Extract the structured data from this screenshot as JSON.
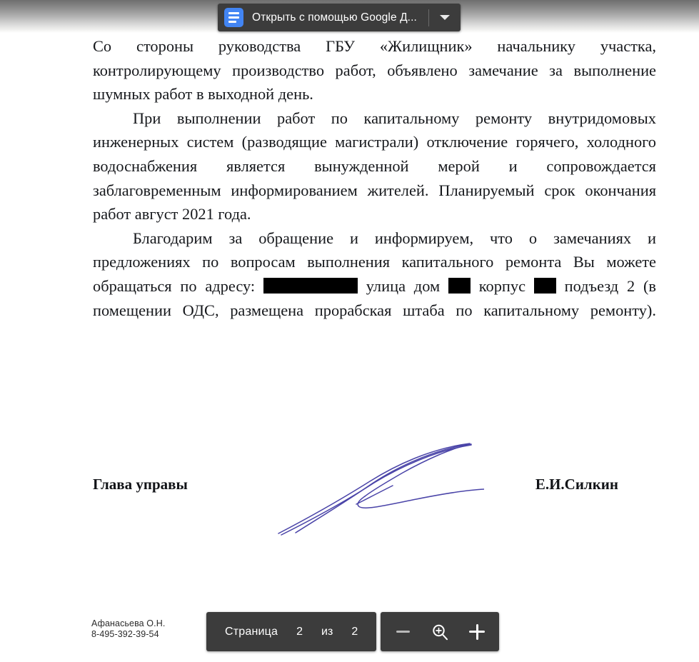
{
  "viewer": {
    "background_color": "#ffffff",
    "toolbar_color": "#3c3c3c"
  },
  "open_with_bar": {
    "icon": "google-docs-icon",
    "icon_color": "#4285f4",
    "label": "Открыть с помощью Google Д...",
    "caret_icon": "chevron-down-icon"
  },
  "document": {
    "paragraphs": [
      {
        "id": "p1",
        "indent": false,
        "segments": [
          {
            "text": "Со стороны руководства "
          },
          {
            "text": "ГБУ «Жилищник»",
            "underline_color": "#e02020"
          },
          {
            "text": " начальнику участка, контролирующему производство работ, объявлено замечание за выполнение шумных работ в выходной день."
          }
        ]
      },
      {
        "id": "p2",
        "indent": true,
        "segments": [
          {
            "text": "При выполнении работ по капитальному ремонту внутридомовых инженерных систем (разводящие магистрали) отключение горячего, холодного водоснабжения является вынужденной мерой и сопровождается заблаговременным информированием жителей. Планируемый срок окончания работ август 2021 года."
          }
        ]
      },
      {
        "id": "p3",
        "indent": true,
        "segments": [
          {
            "text": "Благодарим за обращение и информируем, что о замечаниях и предложениях по вопросам выполнения капитального ремонта Вы можете обращаться по адресу: "
          },
          {
            "redacted": true,
            "size": "wide"
          },
          {
            "text": " улица дом "
          },
          {
            "redacted": true,
            "size": "narrow"
          },
          {
            "text": " корпус "
          },
          {
            "redacted": true,
            "size": "narrow"
          },
          {
            "text": " подъезд 2 (в помещении ОДС, "
          },
          {
            "text": "размещена прорабская штаба",
            "underline_color": "#e02020"
          },
          {
            "text": " по капитальному ремонту)."
          }
        ]
      }
    ],
    "signature": {
      "title": "Глава управы",
      "name": "Е.И.Силкин",
      "ink_color": "#4a44a8"
    },
    "contact": {
      "person": "Афанасьева О.Н.",
      "phone": "8-495-392-39-54"
    }
  },
  "bottom_toolbar": {
    "page_label": "Страница",
    "current_page": "2",
    "of_label": "из",
    "total_pages": "2",
    "zoom_out_icon": "minus-icon",
    "zoom_level_icon": "magnifier-plus-icon",
    "zoom_in_icon": "plus-icon"
  }
}
